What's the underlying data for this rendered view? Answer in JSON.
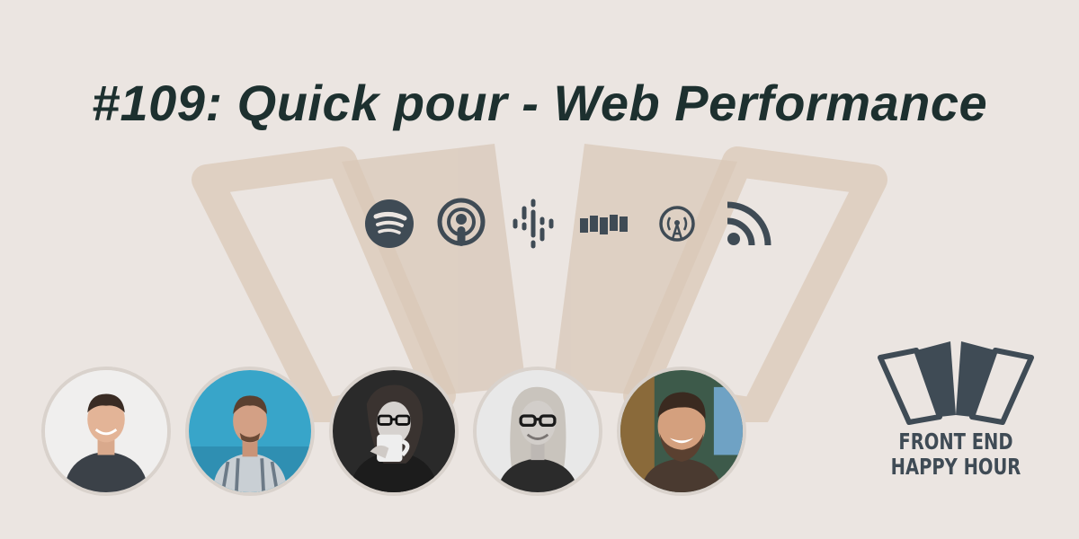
{
  "episode": {
    "title": "#109: Quick pour - Web Performance"
  },
  "platforms": [
    {
      "name": "spotify-icon"
    },
    {
      "name": "apple-podcasts-icon"
    },
    {
      "name": "google-podcasts-icon"
    },
    {
      "name": "stitcher-icon"
    },
    {
      "name": "overcast-icon"
    },
    {
      "name": "rss-icon"
    }
  ],
  "hosts": [
    {
      "name": "avatar-host-1"
    },
    {
      "name": "avatar-host-2"
    },
    {
      "name": "avatar-host-3"
    },
    {
      "name": "avatar-host-4"
    },
    {
      "name": "avatar-host-5"
    }
  ],
  "brand": {
    "line1": "FRONT END",
    "line2": "HAPPY HOUR"
  },
  "colors": {
    "background": "#ebe5e1",
    "title": "#1d302f",
    "icons": "#3f4b55",
    "watermark": "#ddccbb"
  }
}
